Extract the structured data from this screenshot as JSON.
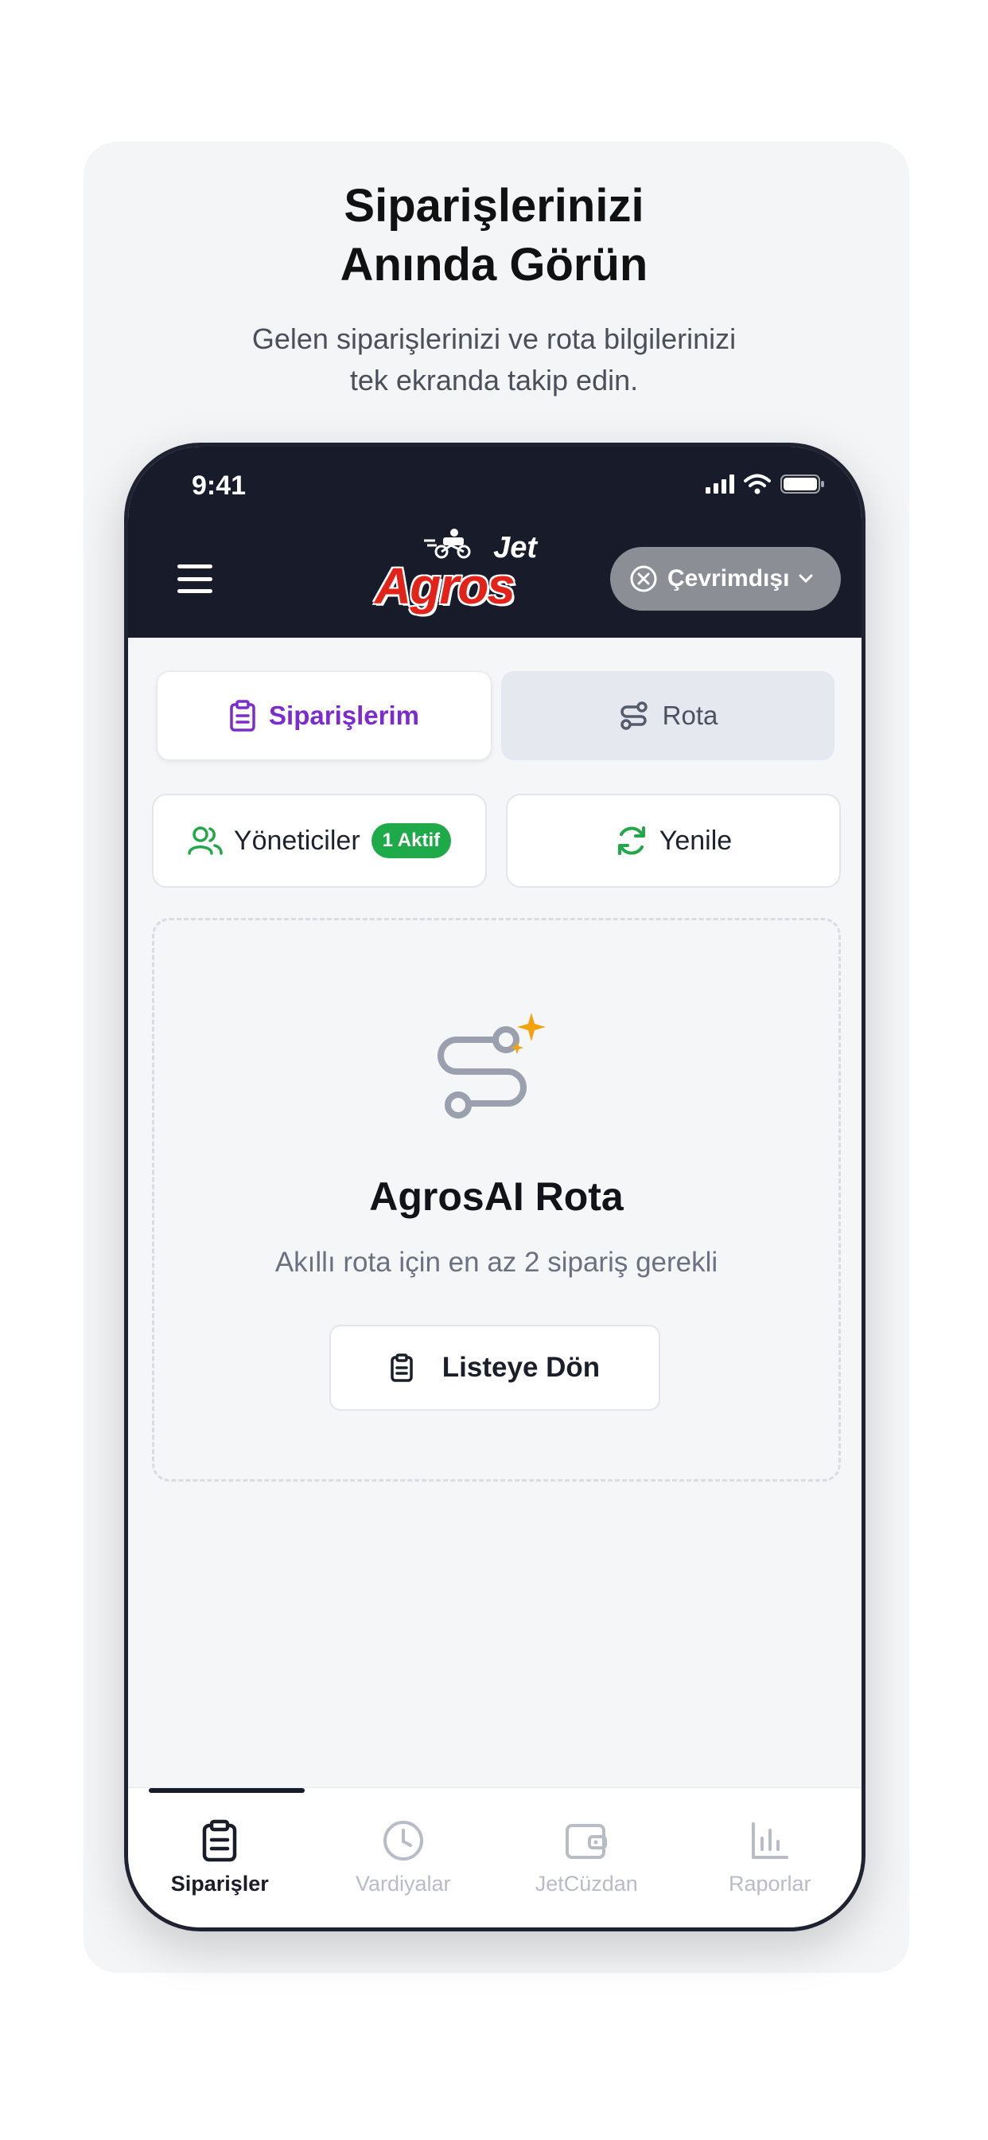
{
  "promo": {
    "title_line1": "Siparişlerinizi",
    "title_line2": "Anında Görün",
    "subtitle_line1": "Gelen siparişlerinizi ve rota bilgilerinizi",
    "subtitle_line2": "tek ekranda takip edin."
  },
  "status_bar": {
    "time": "9:41"
  },
  "header": {
    "logo_top": "Jet",
    "logo_main": "Agros",
    "status_label": "Çevrimdışı"
  },
  "segments": [
    {
      "label": "Siparişlerim",
      "active": true,
      "icon": "clipboard-icon"
    },
    {
      "label": "Rota",
      "active": false,
      "icon": "route-icon"
    }
  ],
  "actions": {
    "managers_label": "Yöneticiler",
    "managers_badge": "1 Aktif",
    "refresh_label": "Yenile"
  },
  "empty_state": {
    "title": "AgrosAI Rota",
    "subtitle": "Akıllı rota için en az 2 sipariş gerekli",
    "button_label": "Listeye Dön"
  },
  "tabbar": [
    {
      "label": "Siparişler",
      "icon": "clipboard-icon",
      "active": true
    },
    {
      "label": "Vardiyalar",
      "icon": "clock-icon",
      "active": false
    },
    {
      "label": "JetCüzdan",
      "icon": "wallet-icon",
      "active": false
    },
    {
      "label": "Raporlar",
      "icon": "bar-chart-icon",
      "active": false
    }
  ],
  "colors": {
    "header_bg": "#171b2a",
    "accent_purple": "#7b2ccf",
    "badge_green": "#1faa4a",
    "refresh_green": "#22a84a",
    "brand_red": "#e2231a",
    "sparkle_orange": "#f4a20c"
  }
}
